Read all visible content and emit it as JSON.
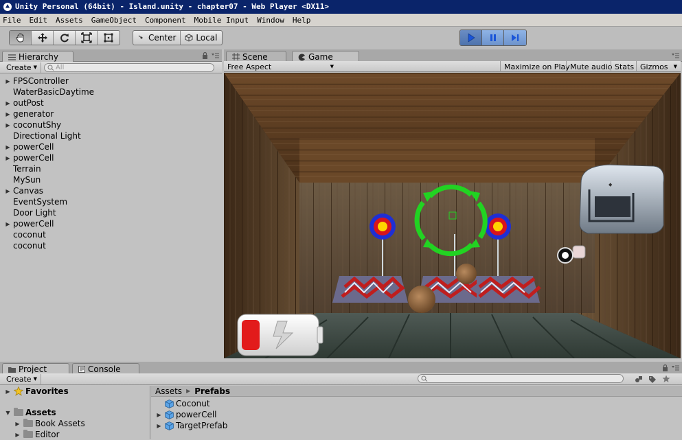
{
  "window": {
    "title": "Unity Personal (64bit) - Island.unity - chapter07 - Web Player <DX11>"
  },
  "menu": [
    "File",
    "Edit",
    "Assets",
    "GameObject",
    "Component",
    "Mobile Input",
    "Window",
    "Help"
  ],
  "toolbar": {
    "tools": [
      "hand-icon",
      "move-icon",
      "rotate-icon",
      "scale-icon",
      "rect-icon"
    ],
    "pivot_label": "Center",
    "space_label": "Local",
    "play_controls": [
      "play-icon",
      "pause-icon",
      "step-icon"
    ]
  },
  "hierarchy": {
    "tab_label": "Hierarchy",
    "create_label": "Create",
    "search_placeholder": "All",
    "items": [
      {
        "label": "FPSController",
        "expandable": true
      },
      {
        "label": "WaterBasicDaytime",
        "expandable": false
      },
      {
        "label": "outPost",
        "expandable": true
      },
      {
        "label": "generator",
        "expandable": true
      },
      {
        "label": "coconutShy",
        "expandable": true
      },
      {
        "label": "Directional Light",
        "expandable": false
      },
      {
        "label": "powerCell",
        "expandable": true
      },
      {
        "label": "powerCell",
        "expandable": true
      },
      {
        "label": "Terrain",
        "expandable": false
      },
      {
        "label": "MySun",
        "expandable": false
      },
      {
        "label": "Canvas",
        "expandable": true
      },
      {
        "label": "EventSystem",
        "expandable": false
      },
      {
        "label": "Door Light",
        "expandable": false
      },
      {
        "label": "powerCell",
        "expandable": true
      },
      {
        "label": "coconut",
        "expandable": false
      },
      {
        "label": "coconut",
        "expandable": false
      }
    ]
  },
  "scene_tab": {
    "label": "Scene"
  },
  "game": {
    "tab_label": "Game",
    "aspect_label": "Free Aspect",
    "maximize_label": "Maximize on Play",
    "mute_label": "Mute audio",
    "stats_label": "Stats",
    "gizmos_label": "Gizmos"
  },
  "project": {
    "tab_label": "Project",
    "console_label": "Console",
    "create_label": "Create",
    "favorites_label": "Favorites",
    "assets_label": "Assets",
    "tree": [
      "Book Assets",
      "Editor"
    ],
    "breadcrumb": [
      "Assets",
      "Prefabs"
    ],
    "items": [
      {
        "label": "Coconut",
        "expandable": false
      },
      {
        "label": "powerCell",
        "expandable": true
      },
      {
        "label": "TargetPrefab",
        "expandable": true
      }
    ]
  },
  "colors": {
    "titlebar": "#0a246a",
    "panel_bg": "#c2c2c2",
    "play_active": "#4e73ad",
    "accent_green": "#22d322"
  }
}
